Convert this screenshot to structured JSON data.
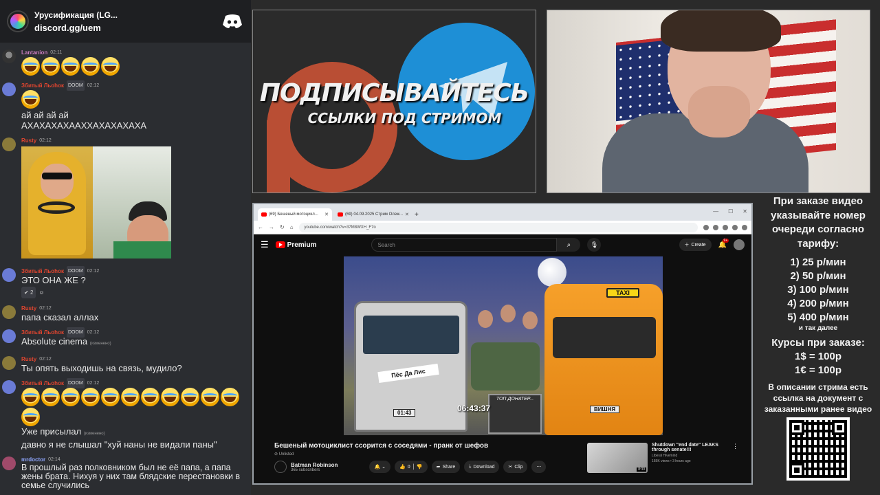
{
  "chat": {
    "server_name": "Урусификация (LG...",
    "server_link": "discord.gg/uem",
    "messages": [
      {
        "user": "Lantanion",
        "color": "#c77bbf",
        "time": "02:11",
        "text": "",
        "emoji_count": 5
      },
      {
        "user": "Збитый Льоhoк",
        "color": "#e0452f",
        "badge": "DOOM",
        "time": "02:12",
        "text": "ай ай ай ай\nАХАХАХАХААХХАХАХАХАХА",
        "emoji_count": 1
      },
      {
        "user": "Rusty",
        "color": "#e0452f",
        "time": "02:12",
        "text": "",
        "gif": true
      },
      {
        "user": "Збитый Льоhoк",
        "color": "#e0452f",
        "badge": "DOOM",
        "time": "02:12",
        "text": "ЭТО ОНА ЖЕ ?",
        "reaction_count": "2"
      },
      {
        "user": "Rusty",
        "color": "#e0452f",
        "time": "02:12",
        "text": "папа сказал аллах"
      },
      {
        "user": "Збитый Льоhoк",
        "color": "#e0452f",
        "badge": "DOOM",
        "time": "02:12",
        "text": "Absolute cinema",
        "tag": "(изменено)"
      },
      {
        "user": "Rusty",
        "color": "#e0452f",
        "time": "02:12",
        "text": "Ты опять выходишь на связь, мудило?"
      },
      {
        "user": "Збитый Льоhoк",
        "color": "#e0452f",
        "badge": "DOOM",
        "time": "02:12",
        "text": "",
        "emoji_count": 12
      },
      {
        "user": "",
        "color": "#e0452f",
        "time": "",
        "text": "Уже присылал",
        "tag": "(изменено)"
      },
      {
        "user": "",
        "color": "#e0452f",
        "time": "",
        "text": "давно я не слышал \"хуй наны не видали паны\""
      },
      {
        "user": "mrdoctor",
        "color": "#8fa7ff",
        "time": "02:14",
        "text": "В прошлый раз полковником был не её папа, а папа жены брата. Нихуя у них там блядские перестановки в семье случились"
      }
    ]
  },
  "banner": {
    "title": "ПОДПИСЫВАЙТЕСЬ",
    "subtitle": "ССЫЛКИ ПОД СТРИМОМ"
  },
  "browser": {
    "tabs": [
      {
        "label": "(69) Бешеный мотоцикл..."
      },
      {
        "label": "(69) 04.09.2025 Стрим Олеж..."
      }
    ],
    "url": "youtube.com/watch?v=37M8WXH_F7o",
    "youtube": {
      "logo": "Premium",
      "search_placeholder": "Search",
      "create_label": "Create",
      "notif_count": "9+",
      "video_timer": "06:43:37",
      "video_labels": {
        "sign": "Пёс Да Лис",
        "taxi": "TAXI",
        "plate_left": "01:43",
        "plate_right": "ВИШНЯ",
        "donater": "ТОП ДОНАТЕР..."
      },
      "video_title": "Бешеный мотоциклист ссорится с соседями - пранк от шефов",
      "visibility": "Unlisted",
      "channel_name": "Batman Robinson",
      "channel_subs": "365 subscribers",
      "likes": "0",
      "share_label": "Share",
      "download_label": "Download",
      "clip_label": "Clip",
      "recommended": {
        "title": "Shutdown \"end date\" LEAKS through senate!!!",
        "channel": "Liberal Hivemind",
        "meta": "155K views • 3 hours ago",
        "duration": "8:30"
      }
    }
  },
  "info": {
    "header_lines": [
      "При заказе видео",
      "указывайте номер",
      "очереди согласно",
      "тарифу:"
    ],
    "prices": [
      "1) 25 р/мин",
      "2) 50 р/мин",
      "3) 100 р/мин",
      "4) 200 р/мин",
      "5) 400 р/мин"
    ],
    "etc": "и так далее",
    "rates_header": "Курсы при заказе:",
    "rates": [
      "1$ = 100р",
      "1€ = 100р"
    ],
    "note": "В описании стрима есть ссылка на документ с заказанными ранее видео"
  }
}
